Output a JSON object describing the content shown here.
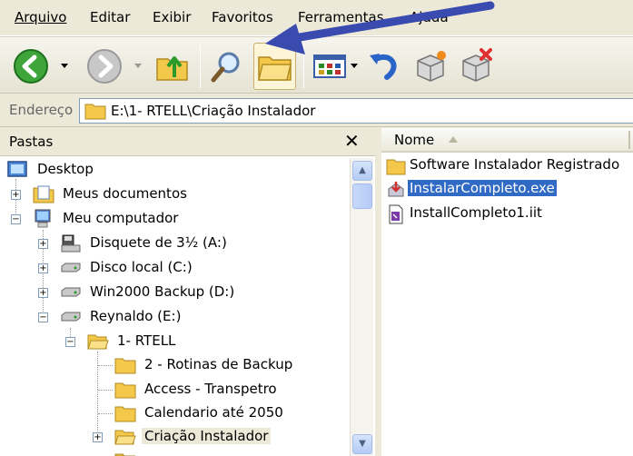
{
  "menu": {
    "items": [
      {
        "label": "Arquivo"
      },
      {
        "label": "Editar"
      },
      {
        "label": "Exibir"
      },
      {
        "label": "Favoritos"
      },
      {
        "label": "Ferramentas"
      },
      {
        "label": "Ajuda"
      }
    ]
  },
  "toolbar": {
    "icons": [
      "back-icon",
      "forward-icon",
      "up-folder-icon",
      "search-icon",
      "folders-icon",
      "views-icon",
      "undo-icon",
      "move-to-icon",
      "delete-icon"
    ]
  },
  "address": {
    "label": "Endereço",
    "path": "E:\\1- RTELL\\Criação Instalador"
  },
  "folders_pane": {
    "title": "Pastas",
    "close": "✕",
    "tree": [
      {
        "label": "Desktop"
      },
      {
        "label": "Meus documentos"
      },
      {
        "label": "Meu computador"
      },
      {
        "label": "Disquete de 3½ (A:)"
      },
      {
        "label": "Disco local (C:)"
      },
      {
        "label": "Win2000 Backup (D:)"
      },
      {
        "label": "Reynaldo (E:)"
      },
      {
        "label": "1- RTELL"
      },
      {
        "label": "2 - Rotinas de Backup"
      },
      {
        "label": "Access - Transpetro"
      },
      {
        "label": "Calendario até 2050"
      },
      {
        "label": "Criação Instalador"
      }
    ]
  },
  "files_pane": {
    "column_name": "Nome",
    "files": [
      {
        "label": "Software Instalador Registrado",
        "type": "folder"
      },
      {
        "label": "InstalarCompleto.exe",
        "type": "exe",
        "selected": true
      },
      {
        "label": "InstallCompleto1.iit",
        "type": "iit"
      }
    ]
  },
  "colors": {
    "selection": "#316ac5",
    "folder_yellow": "#f4c84a",
    "annotation_arrow": "#3a4bb0"
  }
}
